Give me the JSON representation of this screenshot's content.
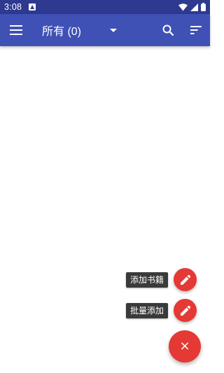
{
  "status_bar": {
    "time": "3:08",
    "icons": [
      "notification-icon",
      "wifi-icon",
      "signal-icon",
      "battery-icon"
    ]
  },
  "toolbar": {
    "title": "所有 (0)",
    "icons": [
      "menu-icon",
      "dropdown-arrow-icon",
      "search-icon",
      "sort-icon"
    ]
  },
  "fab_menu": {
    "add_book_label": "添加书籍",
    "batch_add_label": "批量添加",
    "close_symbol": "×",
    "mini_icon": "pencil-icon"
  },
  "colors": {
    "status_bar": "#2e3a8f",
    "toolbar": "#3f51b5",
    "fab": "#e53935",
    "label_bg": "#3a3a3a"
  }
}
